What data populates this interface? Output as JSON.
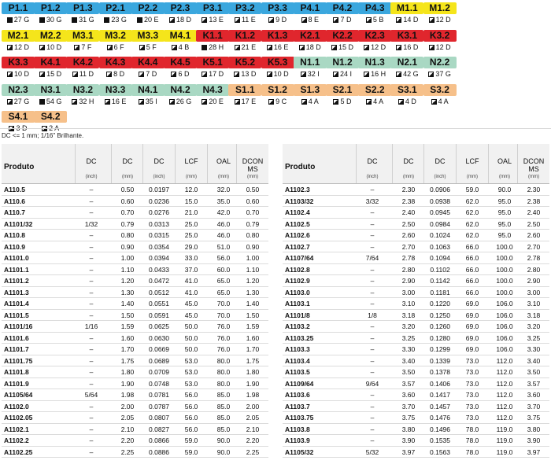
{
  "chips": [
    {
      "code": "P1.1",
      "value": "27 G",
      "color": "blue",
      "marker": "square"
    },
    {
      "code": "P1.2",
      "value": "30 G",
      "color": "blue",
      "marker": "square"
    },
    {
      "code": "P1.3",
      "value": "31 G",
      "color": "blue",
      "marker": "square"
    },
    {
      "code": "P2.1",
      "value": "23 G",
      "color": "blue",
      "marker": "square"
    },
    {
      "code": "P2.2",
      "value": "20 E",
      "color": "blue",
      "marker": "square"
    },
    {
      "code": "P2.3",
      "value": "18 D",
      "color": "blue",
      "marker": "triangle"
    },
    {
      "code": "P3.1",
      "value": "13 E",
      "color": "blue",
      "marker": "triangle"
    },
    {
      "code": "P3.2",
      "value": "11 E",
      "color": "blue",
      "marker": "triangle"
    },
    {
      "code": "P3.3",
      "value": "9 D",
      "color": "blue",
      "marker": "triangle"
    },
    {
      "code": "P4.1",
      "value": "8 E",
      "color": "blue",
      "marker": "triangle"
    },
    {
      "code": "P4.2",
      "value": "7 D",
      "color": "blue",
      "marker": "triangle"
    },
    {
      "code": "P4.3",
      "value": "5 B",
      "color": "blue",
      "marker": "triangle"
    },
    {
      "code": "M1.1",
      "value": "14 D",
      "color": "yellow",
      "marker": "triangle"
    },
    {
      "code": "M1.2",
      "value": "12 D",
      "color": "yellow",
      "marker": "triangle"
    },
    {
      "code": "M2.1",
      "value": "12 D",
      "color": "yellow",
      "marker": "triangle"
    },
    {
      "code": "M2.2",
      "value": "10 D",
      "color": "yellow",
      "marker": "triangle"
    },
    {
      "code": "M3.1",
      "value": "7 F",
      "color": "yellow",
      "marker": "triangle"
    },
    {
      "code": "M3.2",
      "value": "6 F",
      "color": "yellow",
      "marker": "triangle"
    },
    {
      "code": "M3.3",
      "value": "5 F",
      "color": "yellow",
      "marker": "triangle"
    },
    {
      "code": "M4.1",
      "value": "4 B",
      "color": "yellow",
      "marker": "triangle"
    },
    {
      "code": "K1.1",
      "value": "28 H",
      "color": "red",
      "marker": "square"
    },
    {
      "code": "K1.2",
      "value": "21 E",
      "color": "red",
      "marker": "triangle"
    },
    {
      "code": "K1.3",
      "value": "16 E",
      "color": "red",
      "marker": "triangle"
    },
    {
      "code": "K2.1",
      "value": "18 D",
      "color": "red",
      "marker": "triangle"
    },
    {
      "code": "K2.2",
      "value": "15 D",
      "color": "red",
      "marker": "triangle"
    },
    {
      "code": "K2.3",
      "value": "12 D",
      "color": "red",
      "marker": "triangle"
    },
    {
      "code": "K3.1",
      "value": "16 D",
      "color": "red",
      "marker": "triangle"
    },
    {
      "code": "K3.2",
      "value": "12 D",
      "color": "red",
      "marker": "triangle"
    },
    {
      "code": "K3.3",
      "value": "10 D",
      "color": "red",
      "marker": "triangle"
    },
    {
      "code": "K4.1",
      "value": "15 D",
      "color": "red",
      "marker": "triangle"
    },
    {
      "code": "K4.2",
      "value": "11 D",
      "color": "red",
      "marker": "triangle"
    },
    {
      "code": "K4.3",
      "value": "8 D",
      "color": "red",
      "marker": "triangle"
    },
    {
      "code": "K4.4",
      "value": "7 D",
      "color": "red",
      "marker": "triangle"
    },
    {
      "code": "K4.5",
      "value": "6 D",
      "color": "red",
      "marker": "triangle"
    },
    {
      "code": "K5.1",
      "value": "17 D",
      "color": "red",
      "marker": "triangle"
    },
    {
      "code": "K5.2",
      "value": "13 D",
      "color": "red",
      "marker": "triangle"
    },
    {
      "code": "K5.3",
      "value": "10 D",
      "color": "red",
      "marker": "triangle"
    },
    {
      "code": "N1.1",
      "value": "32 I",
      "color": "green",
      "marker": "triangle"
    },
    {
      "code": "N1.2",
      "value": "24 I",
      "color": "green",
      "marker": "triangle"
    },
    {
      "code": "N1.3",
      "value": "16 H",
      "color": "green",
      "marker": "triangle"
    },
    {
      "code": "N2.1",
      "value": "42 G",
      "color": "green",
      "marker": "triangle"
    },
    {
      "code": "N2.2",
      "value": "37 G",
      "color": "green",
      "marker": "triangle"
    },
    {
      "code": "N2.3",
      "value": "27 G",
      "color": "green",
      "marker": "triangle"
    },
    {
      "code": "N3.1",
      "value": "54 G",
      "color": "green",
      "marker": "square"
    },
    {
      "code": "N3.2",
      "value": "32 H",
      "color": "green",
      "marker": "triangle"
    },
    {
      "code": "N3.3",
      "value": "16 E",
      "color": "green",
      "marker": "triangle"
    },
    {
      "code": "N4.1",
      "value": "35 I",
      "color": "green",
      "marker": "triangle"
    },
    {
      "code": "N4.2",
      "value": "26 G",
      "color": "green",
      "marker": "triangle"
    },
    {
      "code": "N4.3",
      "value": "20 E",
      "color": "green",
      "marker": "triangle"
    },
    {
      "code": "S1.1",
      "value": "17 E",
      "color": "orange",
      "marker": "triangle"
    },
    {
      "code": "S1.2",
      "value": "9 C",
      "color": "orange",
      "marker": "triangle"
    },
    {
      "code": "S1.3",
      "value": "4 A",
      "color": "orange",
      "marker": "triangle"
    },
    {
      "code": "S2.1",
      "value": "5 D",
      "color": "orange",
      "marker": "triangle"
    },
    {
      "code": "S2.2",
      "value": "4 A",
      "color": "orange",
      "marker": "triangle"
    },
    {
      "code": "S3.1",
      "value": "4 D",
      "color": "orange",
      "marker": "triangle"
    },
    {
      "code": "S3.2",
      "value": "4 A",
      "color": "orange",
      "marker": "triangle"
    },
    {
      "code": "S4.1",
      "value": "3 D",
      "color": "orange",
      "marker": "triangle"
    },
    {
      "code": "S4.2",
      "value": "2 A",
      "color": "orange",
      "marker": "triangle"
    }
  ],
  "colors": {
    "blue": "#3aa7de",
    "yellow": "#f5e51b",
    "red": "#e0262d",
    "green": "#a9d8c3",
    "orange": "#f6c08a"
  },
  "note": "DC <= 1 mm; 1/16\" Brilhante.",
  "table": {
    "col_product": "Produto",
    "headers": [
      "DC",
      "DC",
      "DC",
      "LCF",
      "OAL",
      "DCON MS"
    ],
    "units": [
      "(inch)",
      "(mm)",
      "(inch)",
      "(mm)",
      "(mm)",
      "(mm)"
    ]
  },
  "left_rows": [
    [
      "A110.5",
      "–",
      "0.50",
      "0.0197",
      "12.0",
      "32.0",
      "0.50"
    ],
    [
      "A110.6",
      "–",
      "0.60",
      "0.0236",
      "15.0",
      "35.0",
      "0.60"
    ],
    [
      "A110.7",
      "–",
      "0.70",
      "0.0276",
      "21.0",
      "42.0",
      "0.70"
    ],
    [
      "A1101/32",
      "1/32",
      "0.79",
      "0.0313",
      "25.0",
      "46.0",
      "0.79"
    ],
    [
      "A110.8",
      "–",
      "0.80",
      "0.0315",
      "25.0",
      "46.0",
      "0.80"
    ],
    [
      "A110.9",
      "–",
      "0.90",
      "0.0354",
      "29.0",
      "51.0",
      "0.90"
    ],
    [
      "A1101.0",
      "–",
      "1.00",
      "0.0394",
      "33.0",
      "56.0",
      "1.00"
    ],
    [
      "A1101.1",
      "–",
      "1.10",
      "0.0433",
      "37.0",
      "60.0",
      "1.10"
    ],
    [
      "A1101.2",
      "–",
      "1.20",
      "0.0472",
      "41.0",
      "65.0",
      "1.20"
    ],
    [
      "A1101.3",
      "–",
      "1.30",
      "0.0512",
      "41.0",
      "65.0",
      "1.30"
    ],
    [
      "A1101.4",
      "–",
      "1.40",
      "0.0551",
      "45.0",
      "70.0",
      "1.40"
    ],
    [
      "A1101.5",
      "–",
      "1.50",
      "0.0591",
      "45.0",
      "70.0",
      "1.50"
    ],
    [
      "A1101/16",
      "1/16",
      "1.59",
      "0.0625",
      "50.0",
      "76.0",
      "1.59"
    ],
    [
      "A1101.6",
      "–",
      "1.60",
      "0.0630",
      "50.0",
      "76.0",
      "1.60"
    ],
    [
      "A1101.7",
      "–",
      "1.70",
      "0.0669",
      "50.0",
      "76.0",
      "1.70"
    ],
    [
      "A1101.75",
      "–",
      "1.75",
      "0.0689",
      "53.0",
      "80.0",
      "1.75"
    ],
    [
      "A1101.8",
      "–",
      "1.80",
      "0.0709",
      "53.0",
      "80.0",
      "1.80"
    ],
    [
      "A1101.9",
      "–",
      "1.90",
      "0.0748",
      "53.0",
      "80.0",
      "1.90"
    ],
    [
      "A1105/64",
      "5/64",
      "1.98",
      "0.0781",
      "56.0",
      "85.0",
      "1.98"
    ],
    [
      "A1102.0",
      "–",
      "2.00",
      "0.0787",
      "56.0",
      "85.0",
      "2.00"
    ],
    [
      "A1102.05",
      "–",
      "2.05",
      "0.0807",
      "56.0",
      "85.0",
      "2.05"
    ],
    [
      "A1102.1",
      "–",
      "2.10",
      "0.0827",
      "56.0",
      "85.0",
      "2.10"
    ],
    [
      "A1102.2",
      "–",
      "2.20",
      "0.0866",
      "59.0",
      "90.0",
      "2.20"
    ],
    [
      "A1102.25",
      "–",
      "2.25",
      "0.0886",
      "59.0",
      "90.0",
      "2.25"
    ]
  ],
  "right_rows": [
    [
      "A1102.3",
      "–",
      "2.30",
      "0.0906",
      "59.0",
      "90.0",
      "2.30"
    ],
    [
      "A1103/32",
      "3/32",
      "2.38",
      "0.0938",
      "62.0",
      "95.0",
      "2.38"
    ],
    [
      "A1102.4",
      "–",
      "2.40",
      "0.0945",
      "62.0",
      "95.0",
      "2.40"
    ],
    [
      "A1102.5",
      "–",
      "2.50",
      "0.0984",
      "62.0",
      "95.0",
      "2.50"
    ],
    [
      "A1102.6",
      "–",
      "2.60",
      "0.1024",
      "62.0",
      "95.0",
      "2.60"
    ],
    [
      "A1102.7",
      "–",
      "2.70",
      "0.1063",
      "66.0",
      "100.0",
      "2.70"
    ],
    [
      "A1107/64",
      "7/64",
      "2.78",
      "0.1094",
      "66.0",
      "100.0",
      "2.78"
    ],
    [
      "A1102.8",
      "–",
      "2.80",
      "0.1102",
      "66.0",
      "100.0",
      "2.80"
    ],
    [
      "A1102.9",
      "–",
      "2.90",
      "0.1142",
      "66.0",
      "100.0",
      "2.90"
    ],
    [
      "A1103.0",
      "–",
      "3.00",
      "0.1181",
      "66.0",
      "100.0",
      "3.00"
    ],
    [
      "A1103.1",
      "–",
      "3.10",
      "0.1220",
      "69.0",
      "106.0",
      "3.10"
    ],
    [
      "A1101/8",
      "1/8",
      "3.18",
      "0.1250",
      "69.0",
      "106.0",
      "3.18"
    ],
    [
      "A1103.2",
      "–",
      "3.20",
      "0.1260",
      "69.0",
      "106.0",
      "3.20"
    ],
    [
      "A1103.25",
      "–",
      "3.25",
      "0.1280",
      "69.0",
      "106.0",
      "3.25"
    ],
    [
      "A1103.3",
      "–",
      "3.30",
      "0.1299",
      "69.0",
      "106.0",
      "3.30"
    ],
    [
      "A1103.4",
      "–",
      "3.40",
      "0.1339",
      "73.0",
      "112.0",
      "3.40"
    ],
    [
      "A1103.5",
      "–",
      "3.50",
      "0.1378",
      "73.0",
      "112.0",
      "3.50"
    ],
    [
      "A1109/64",
      "9/64",
      "3.57",
      "0.1406",
      "73.0",
      "112.0",
      "3.57"
    ],
    [
      "A1103.6",
      "–",
      "3.60",
      "0.1417",
      "73.0",
      "112.0",
      "3.60"
    ],
    [
      "A1103.7",
      "–",
      "3.70",
      "0.1457",
      "73.0",
      "112.0",
      "3.70"
    ],
    [
      "A1103.75",
      "–",
      "3.75",
      "0.1476",
      "73.0",
      "112.0",
      "3.75"
    ],
    [
      "A1103.8",
      "–",
      "3.80",
      "0.1496",
      "78.0",
      "119.0",
      "3.80"
    ],
    [
      "A1103.9",
      "–",
      "3.90",
      "0.1535",
      "78.0",
      "119.0",
      "3.90"
    ],
    [
      "A1105/32",
      "5/32",
      "3.97",
      "0.1563",
      "78.0",
      "119.0",
      "3.97"
    ]
  ]
}
